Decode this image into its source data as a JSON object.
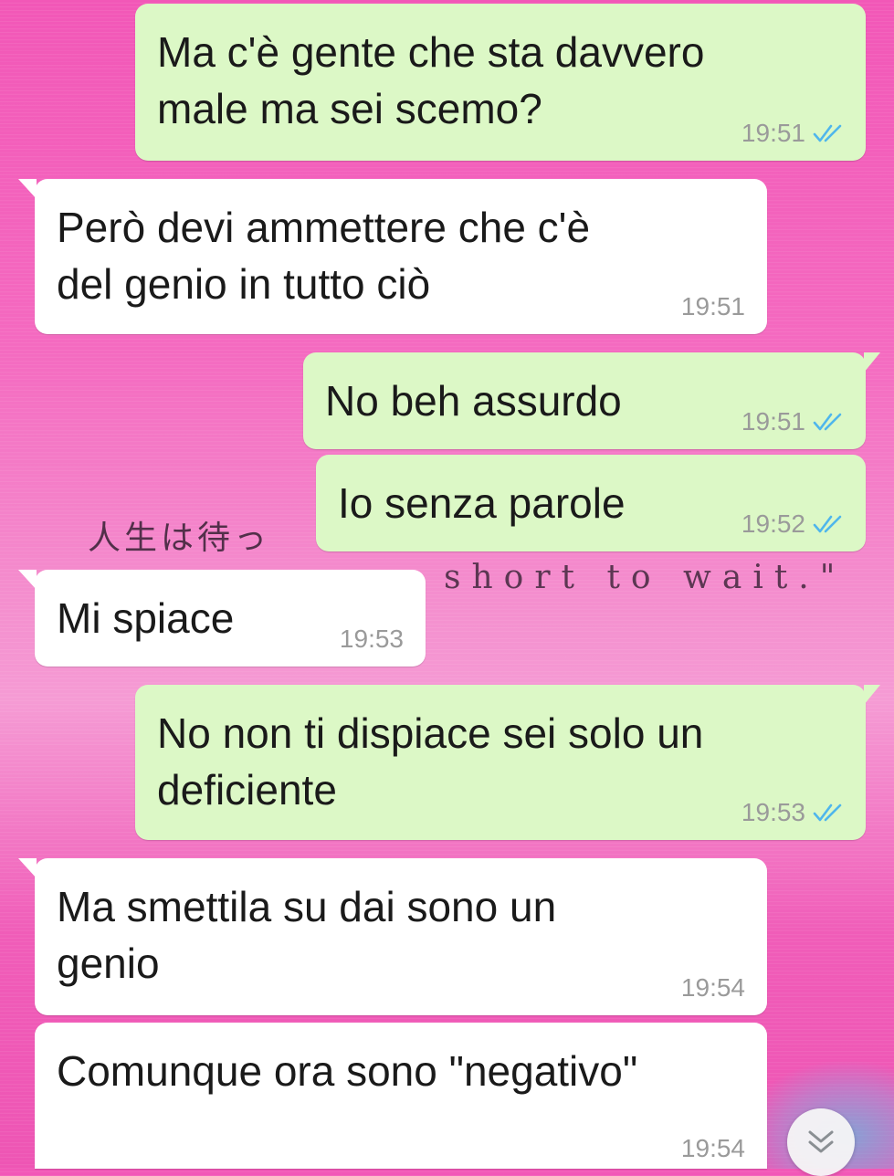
{
  "wallpaper": {
    "japanese": "人生は待っ",
    "english": "short to wait.\""
  },
  "messages": [
    {
      "dir": "out",
      "text": "Ma c'è gente che sta davvero\nmale ma sei scemo?",
      "time": "19:51",
      "status": "read"
    },
    {
      "dir": "in",
      "text": "Però devi ammettere che c'è\ndel genio in tutto ciò",
      "time": "19:51"
    },
    {
      "dir": "out",
      "text": "No beh assurdo",
      "time": "19:51",
      "status": "read"
    },
    {
      "dir": "out",
      "text": "Io senza parole",
      "time": "19:52",
      "status": "read"
    },
    {
      "dir": "in",
      "text": "Mi spiace",
      "time": "19:53"
    },
    {
      "dir": "out",
      "text": "No non ti dispiace sei solo un\ndeficiente",
      "time": "19:53",
      "status": "read"
    },
    {
      "dir": "in",
      "text": "Ma smettila su dai sono un\ngenio",
      "time": "19:54"
    },
    {
      "dir": "in",
      "text": "Comunque ora sono \"negativo\"",
      "time": "19:54"
    }
  ],
  "icons": {
    "read_ticks": "double-check-icon",
    "scroll_down": "chevron-double-down-icon"
  },
  "colors": {
    "outgoing_bubble": "#dcf8c6",
    "incoming_bubble": "#ffffff",
    "read_ticks": "#4fb6ec",
    "time_text": "#9a9a9a"
  }
}
